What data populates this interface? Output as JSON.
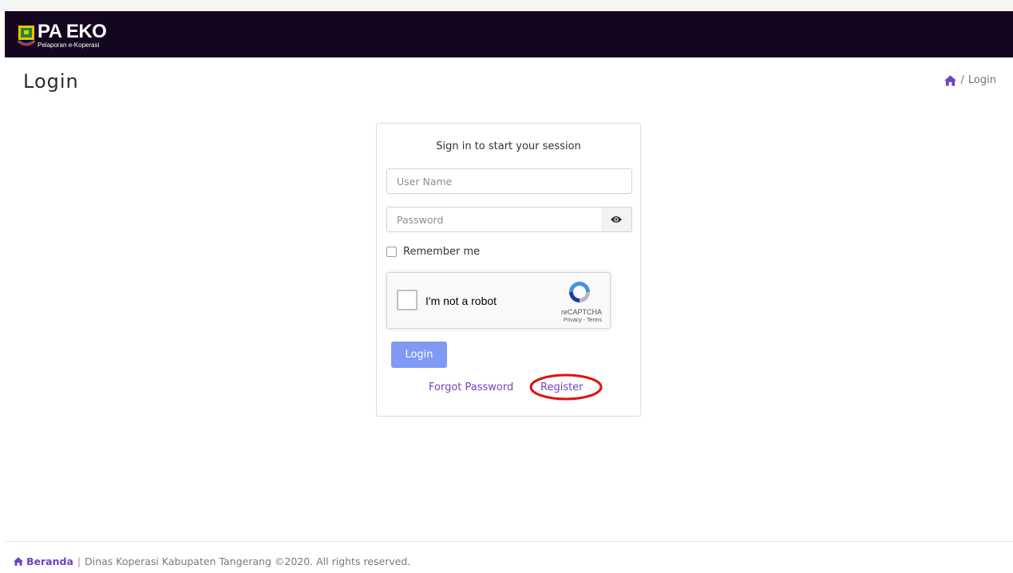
{
  "header": {
    "brand_title": "PA EKO",
    "brand_subtitle": "Pelaporan e-Koperasi"
  },
  "page": {
    "title": "Login",
    "breadcrumb": {
      "separator": "/",
      "current": "Login"
    }
  },
  "login_form": {
    "message": "Sign in to start your session",
    "username_placeholder": "User Name",
    "password_placeholder": "Password",
    "remember_label": "Remember me",
    "login_button": "Login",
    "forgot_link": "Forgot Password",
    "register_link": "Register"
  },
  "recaptcha": {
    "label": "I'm not a robot",
    "brand": "reCAPTCHA",
    "terms": "Privacy - Terms"
  },
  "footer": {
    "home_link": "Beranda",
    "separator": "|",
    "text": "Dinas Koperasi Kabupaten Tangerang ©2020. All rights reserved."
  },
  "colors": {
    "navbar": "#14061e",
    "accent": "#6f42c1",
    "login_button": "#7f99f5",
    "highlight_ring": "#e01010"
  }
}
